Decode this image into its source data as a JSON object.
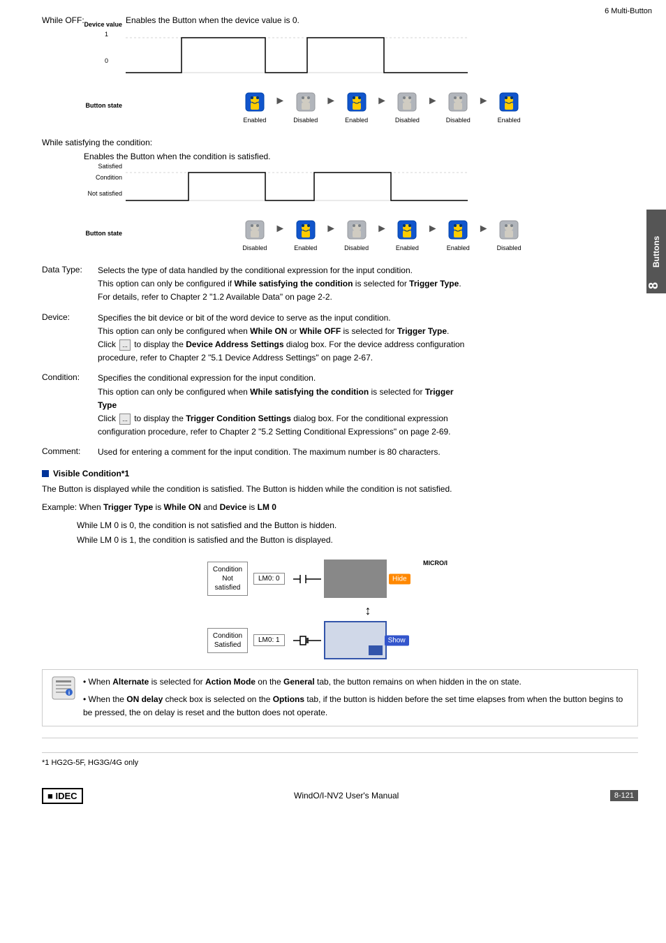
{
  "page": {
    "top_right": "6 Multi-Button",
    "page_number": "8-121",
    "footer_center": "WindO/I-NV2 User's Manual",
    "sidebar_text": "Buttons",
    "chapter_num": "8"
  },
  "while_off": {
    "label": "While OFF:",
    "description": "Enables the Button when the device value is 0.",
    "device_value_label": "Device value",
    "button_state_label": "Button state",
    "wave_1": "1",
    "wave_0": "0",
    "states": [
      "Enabled",
      "Disabled",
      "Enabled",
      "Disabled",
      "Disabled",
      "Enabled"
    ]
  },
  "while_satisfying": {
    "label": "While satisfying the condition:",
    "description": "Enables the Button when the condition is satisfied.",
    "satisfied_label": "Satisfied",
    "condition_label": "Condition",
    "not_satisfied_label": "Not satisfied",
    "button_state_label": "Button state",
    "states": [
      "Disabled",
      "Enabled",
      "Disabled",
      "Enabled",
      "Enabled",
      "Disabled"
    ]
  },
  "params": {
    "data_type": {
      "name": "Data Type:",
      "desc_line1": "Selects the type of data handled by the conditional expression for the input condition.",
      "desc_line2": "This option can only be configured if ",
      "bold1": "While satisfying the condition",
      "desc_line2b": " is selected for ",
      "bold2": "Trigger Type",
      "desc_line2c": ".",
      "desc_line3": "For details, refer to Chapter 2 \"1.2 Available Data\" on page 2-2."
    },
    "device": {
      "name": "Device:",
      "desc_line1": "Specifies the bit device or bit of the word device to serve as the input condition.",
      "desc_line2": "This option can only be configured when ",
      "bold1": "While ON",
      "desc_line2b": " or ",
      "bold2": "While OFF",
      "desc_line2c": " is selected for ",
      "bold3": "Trigger Type",
      "desc_line2d": ".",
      "desc_line3a": "Click ",
      "btn_label": "...",
      "desc_line3b": " to display the ",
      "bold4": "Device Address Settings",
      "desc_line3c": " dialog box. For the device address configuration",
      "desc_line3d": "procedure, refer to Chapter 2 \"5.1 Device Address Settings\" on page 2-67."
    },
    "condition": {
      "name": "Condition:",
      "desc_line1": "Specifies the conditional expression for the input condition.",
      "desc_line2": "This option can only be configured when ",
      "bold1": "While satisfying the condition",
      "desc_line2b": " is selected for ",
      "bold2": "Trigger",
      "desc_line2c": "",
      "desc_line2d": "Type",
      "desc_line3a": "Click ",
      "btn_label": "...",
      "desc_line3b": " to display the ",
      "bold3": "Trigger Condition Settings",
      "desc_line3c": " dialog box. For the conditional expression",
      "desc_line3d": "configuration procedure, refer to Chapter 2 \"5.2 Setting Conditional Expressions\" on page 2-69."
    },
    "comment": {
      "name": "Comment:",
      "desc": "Used for entering a comment for the input condition. The maximum number is 80 characters."
    }
  },
  "visible_condition": {
    "title": "Visible Condition*1",
    "desc1": "The Button is displayed while the condition is satisfied. The Button is hidden while the condition is not satisfied.",
    "example_label": "Example: When ",
    "bold1": "Trigger Type",
    "example_mid": " is ",
    "bold2": "While ON",
    "example_mid2": " and ",
    "bold3": "Device",
    "example_mid3": " is ",
    "bold4": "LM 0",
    "line1": "While LM 0 is 0, the condition is not satisfied and the Button is hidden.",
    "line2": "While LM 0 is 1, the condition is satisfied and the Button is displayed.",
    "diagram": {
      "micro_label": "MICRO/I",
      "top_box_label": "Condition\nNot\nsatisfied",
      "top_lmo": "LM0: 0",
      "hide_btn": "Hide",
      "bottom_box_label": "Condition\nSatisfied",
      "bottom_lmo": "LM0: 1",
      "show_btn": "Show"
    }
  },
  "notes": [
    {
      "bullet": "•",
      "text_start": "When ",
      "bold1": "Alternate",
      "text_mid": " is selected for ",
      "bold2": "Action Mode",
      "text_mid2": " on the ",
      "bold3": "General",
      "text_end": " tab, the button remains on when hidden in the on state."
    },
    {
      "bullet": "•",
      "text_start": "When the ",
      "bold1": "ON delay",
      "text_mid": " check box is selected on the ",
      "bold2": "Options",
      "text_mid2": " tab, if the button is hidden before the set time elapses from when the button begins to be pressed, the on delay is reset and the button does not operate."
    }
  ],
  "footnote": "*1  HG2G-5F, HG3G/4G only"
}
